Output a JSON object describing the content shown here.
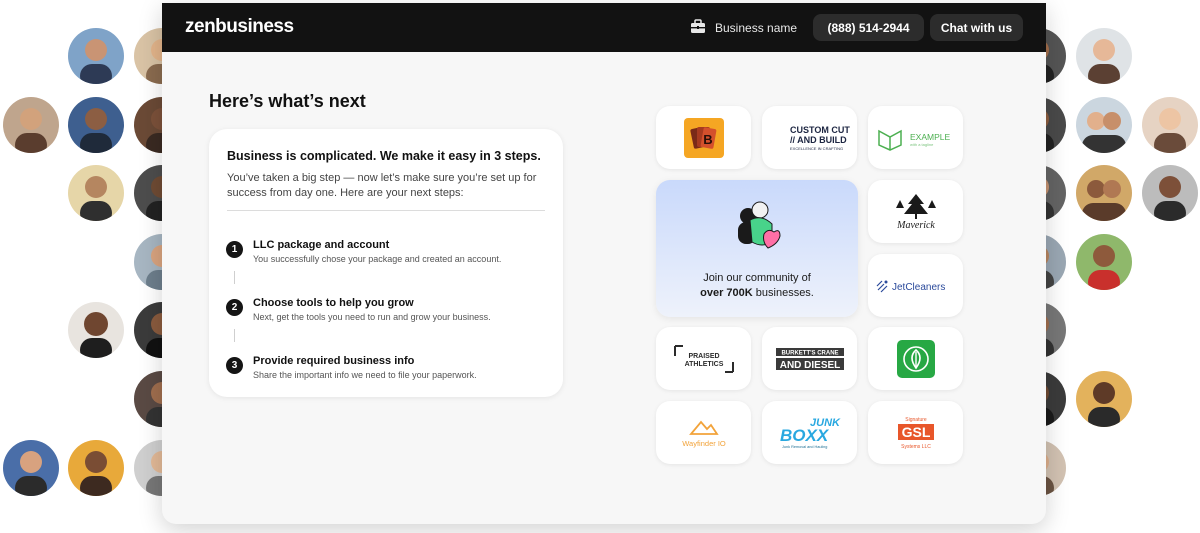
{
  "header": {
    "logo": "zenbusiness",
    "business_name": "Business name",
    "phone": "(888) 514-2944",
    "chat": "Chat with us"
  },
  "main": {
    "heading": "Here’s what’s next",
    "card": {
      "title": "Business is complicated. We make it easy in 3 steps.",
      "description": "You’ve taken a big step — now let’s make sure you’re set up for success from day one. Here are your next steps:",
      "steps": [
        {
          "number": "1",
          "title": "LLC package and account",
          "description": "You successfully chose your package and created an account."
        },
        {
          "number": "2",
          "title": "Choose tools to help you grow",
          "description": "Next, get the tools you need to run and grow your business."
        },
        {
          "number": "3",
          "title": "Provide required business info",
          "description": "Share the important info we need to file your paperwork."
        }
      ]
    }
  },
  "community": {
    "line1": "Join our community of",
    "highlight": "over 700K",
    "line2_rest": " businesses."
  },
  "logos": {
    "custom_cut_line1": "CUSTOM CUT",
    "custom_cut_line2": "// AND BUILD",
    "custom_cut_tag": "EXCELLENCE IN CRAFTING",
    "example": "EXAMPLE",
    "example_tag": "with a tagline",
    "maverick": "Maverick",
    "jetcleaners": "JetCleaners",
    "praised_line1": "PRAISED",
    "praised_line2": "ATHLETICS",
    "burketts_line1": "BURKETT'S CRANE",
    "burketts_line2": "AND DIESEL",
    "wayfinder": "Wayfinder IO",
    "junk_top": "JUNK",
    "junk_main": "BOXX",
    "junk_tag": "Junk Removal and Hauling",
    "gsl_top": "Signature",
    "gsl_main": "GSL",
    "gsl_bottom": "Systems LLC"
  },
  "colors": {
    "topbar": "#121212",
    "pill": "#2c2c2c",
    "brand_orange": "#f5a623",
    "example_green": "#4caf50",
    "jet_blue": "#2b4a9b",
    "junk_blue": "#29a8e0",
    "gsl_orange": "#e8562a"
  }
}
